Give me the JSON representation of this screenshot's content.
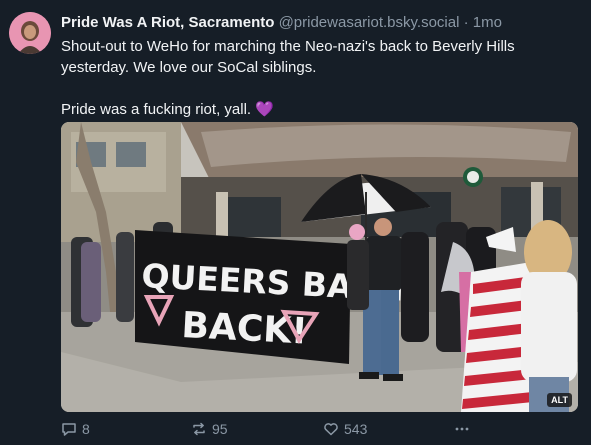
{
  "post": {
    "author_name": "Pride Was A Riot, Sacramento",
    "author_handle": "@pridewasariot.bsky.social",
    "separator": "·",
    "timestamp": "1mo",
    "text_line1": "Shout-out to WeHo for marching the Neo-nazi's back to Beverly Hills yesterday. We love our SoCal siblings.",
    "text_line2": "Pride was a fucking riot, yall.",
    "emoji": "💜",
    "image": {
      "banner_line1": "QUEERS BASH",
      "banner_line2": "BACK!",
      "alt_badge": "ALT"
    },
    "counts": {
      "replies": "8",
      "reposts": "95",
      "likes": "543"
    }
  },
  "icons": {
    "reply": "reply-icon",
    "repost": "repost-icon",
    "like": "heart-icon",
    "more": "more-icon"
  },
  "colors": {
    "background": "#161e27",
    "text": "#f1f3f5",
    "muted": "#8b98a5"
  }
}
